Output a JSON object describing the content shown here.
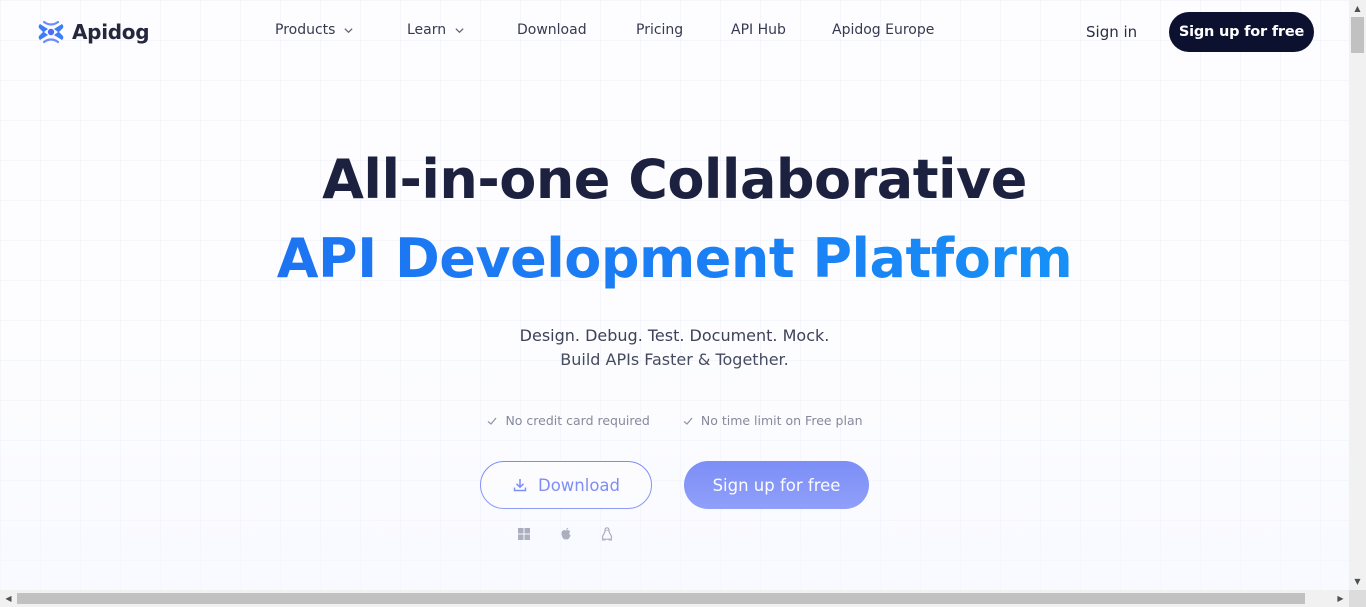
{
  "brand": {
    "name": "Apidog",
    "logo_icon": "apidog-logo-icon",
    "accent": "#4b63f5",
    "dark": "#0d1130"
  },
  "nav": {
    "items": [
      {
        "label": "Products",
        "has_dropdown": true
      },
      {
        "label": "Learn",
        "has_dropdown": true
      },
      {
        "label": "Download",
        "has_dropdown": false
      },
      {
        "label": "Pricing",
        "has_dropdown": false
      },
      {
        "label": "API Hub",
        "has_dropdown": false
      },
      {
        "label": "Apidog Europe",
        "has_dropdown": false
      }
    ],
    "signin": "Sign in",
    "signup": "Sign up for free"
  },
  "hero": {
    "headline_line1": "All-in-one Collaborative",
    "headline_line2": "API Development Platform",
    "subtitle_line1": "Design. Debug. Test. Document. Mock.",
    "subtitle_line2": "Build APIs Faster & Together.",
    "checks": [
      "No credit card required",
      "No time limit on Free plan"
    ],
    "download_button": "Download",
    "signup_button": "Sign up for free",
    "platform_icons": [
      "windows-icon",
      "apple-icon",
      "linux-icon"
    ]
  },
  "colors": {
    "headline_dark": "#1d2140",
    "headline_blue": "#1f78f2"
  }
}
